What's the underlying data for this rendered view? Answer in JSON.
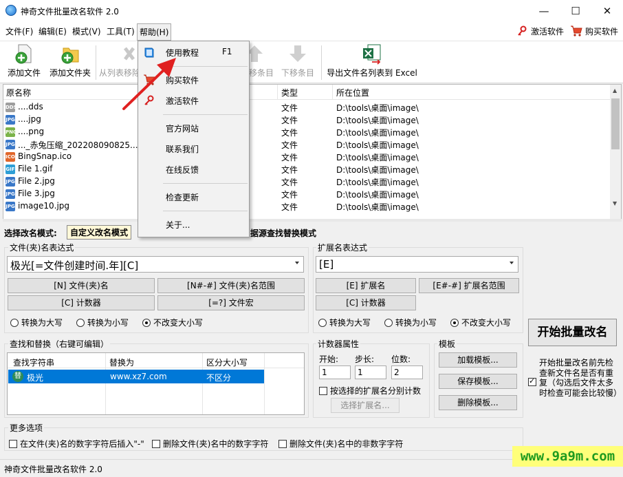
{
  "window": {
    "title": "神奇文件批量改名软件 2.0",
    "min": "—",
    "max": "☐",
    "close": "✕"
  },
  "menubar": {
    "items": [
      "文件(F)",
      "编辑(E)",
      "模式(V)",
      "工具(T)",
      "帮助(H)"
    ],
    "activate": "激活软件",
    "buy": "购买软件"
  },
  "toolbar": {
    "add_file": "添加文件",
    "add_folder": "添加文件夹",
    "remove": "从列表移除",
    "move_up": "上移条目",
    "move_down": "下移条目",
    "export": "导出文件名列表到 Excel"
  },
  "help_menu": {
    "tutorial": "使用教程",
    "tutorial_key": "F1",
    "buy": "购买软件",
    "activate": "激活软件",
    "website": "官方网站",
    "contact": "联系我们",
    "feedback": "在线反馈",
    "update": "检查更新",
    "about": "关于..."
  },
  "file_list": {
    "headers": {
      "name": "原名称",
      "type": "类型",
      "location": "所在位置"
    },
    "rows": [
      {
        "name": "....dds",
        "type": "文件",
        "location": "D:\\tools\\桌面\\image\\",
        "icon": "dds-file-icon"
      },
      {
        "name": "....jpg",
        "type": "文件",
        "location": "D:\\tools\\桌面\\image\\",
        "icon": "jpg-file-icon"
      },
      {
        "name": "....png",
        "type": "文件",
        "location": "D:\\tools\\桌面\\image\\",
        "icon": "png-file-icon"
      },
      {
        "name": "..._赤兔压缩_202208090825...",
        "type": "文件",
        "location": "D:\\tools\\桌面\\image\\",
        "icon": "jpg-file-icon"
      },
      {
        "name": "BingSnap.ico",
        "type": "文件",
        "location": "D:\\tools\\桌面\\image\\",
        "icon": "ico-file-icon"
      },
      {
        "name": "File 1.gif",
        "type": "文件",
        "location": "D:\\tools\\桌面\\image\\",
        "icon": "gif-file-icon"
      },
      {
        "name": "File 2.jpg",
        "type": "文件",
        "location": "D:\\tools\\桌面\\image\\",
        "icon": "jpg-file-icon"
      },
      {
        "name": "File 3.jpg",
        "type": "文件",
        "location": "D:\\tools\\桌面\\image\\",
        "icon": "jpg-file-icon"
      },
      {
        "name": "image10.jpg",
        "type": "文件",
        "location": "D:\\tools\\桌面\\image\\",
        "icon": "jpg-file-icon"
      }
    ]
  },
  "mode": {
    "label": "选择改名模式:",
    "tabs": [
      "自定义改名模式",
      "据源查找替换模式"
    ]
  },
  "filename_expr": {
    "label": "文件(夹)名表达式",
    "value": "极光[=文件创建时间.年][C]",
    "btn_n": "[N] 文件(夹)名",
    "btn_range": "[N#-#] 文件(夹)名范围",
    "btn_counter": "[C] 计数器",
    "btn_macro": "[=?] 文件宏",
    "radios": [
      "转换为大写",
      "转换为小写",
      "不改变大小写"
    ]
  },
  "ext_expr": {
    "label": "扩展名表达式",
    "value": "[E]",
    "btn_e": "[E] 扩展名",
    "btn_range": "[E#-#] 扩展名范围",
    "btn_counter": "[C] 计数器",
    "radios": [
      "转换为大写",
      "转换为小写",
      "不改变大小写"
    ]
  },
  "start_button": "开始批量改名",
  "check_dup": "开始批量改名前先检查新文件名是否有重复（勾选后文件太多时检查可能会比较慢）",
  "find_replace": {
    "label": "查找和替换（右键可编辑）",
    "headers": [
      "查找字符串",
      "替换为",
      "区分大小写"
    ],
    "row": {
      "badge": "替",
      "find": "极光",
      "replace": "www.xz7.com",
      "case": "不区分"
    }
  },
  "counter": {
    "label": "计数器属性",
    "start_label": "开始:",
    "step_label": "步长:",
    "digits_label": "位数:",
    "start": "1",
    "step": "1",
    "digits": "2",
    "per_ext": "按选择的扩展名分别计数",
    "choose_ext": "选择扩展名..."
  },
  "template": {
    "label": "模板",
    "load": "加载模板...",
    "save": "保存模板...",
    "delete": "删除模板..."
  },
  "more_options": {
    "label": "更多选项",
    "opt1": "在文件(夹)名的数字字符后插入\"-\"",
    "opt2": "删除文件(夹)名中的数字字符",
    "opt3": "删除文件(夹)名中的非数字字符"
  },
  "status": "神奇文件批量改名软件 2.0",
  "watermark": "www.9a9m.com",
  "colors": {
    "accent": "#0078d7",
    "arrow": "#e02020",
    "selected_row": "#0078d7",
    "watermark_bg": "#ffff7a"
  }
}
